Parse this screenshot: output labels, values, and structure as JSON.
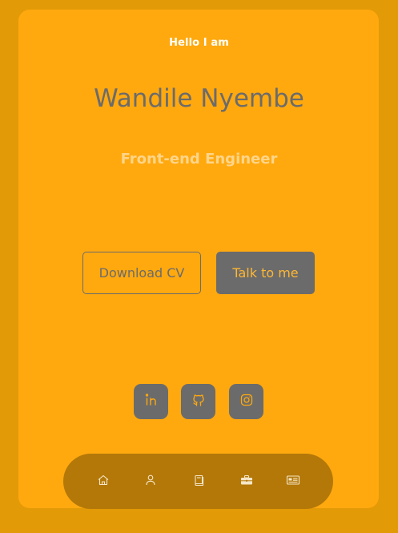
{
  "header": {
    "greeting": "Hello I am",
    "name": "Wandile Nyembe",
    "role": "Front-end Engineer"
  },
  "actions": {
    "download_label": "Download CV",
    "talk_label": "Talk to me"
  },
  "socials": [
    {
      "icon": "linkedin-icon"
    },
    {
      "icon": "github-icon"
    },
    {
      "icon": "instagram-icon"
    }
  ],
  "nav": [
    {
      "icon": "home-icon"
    },
    {
      "icon": "user-icon"
    },
    {
      "icon": "book-icon"
    },
    {
      "icon": "briefcase-icon"
    },
    {
      "icon": "message-icon"
    }
  ],
  "colors": {
    "background": "#e39a07",
    "card": "#ffa90f",
    "accent_gray": "#6b6b6b",
    "nav_bar": "#b37808",
    "role_text": "#ffd58a"
  }
}
